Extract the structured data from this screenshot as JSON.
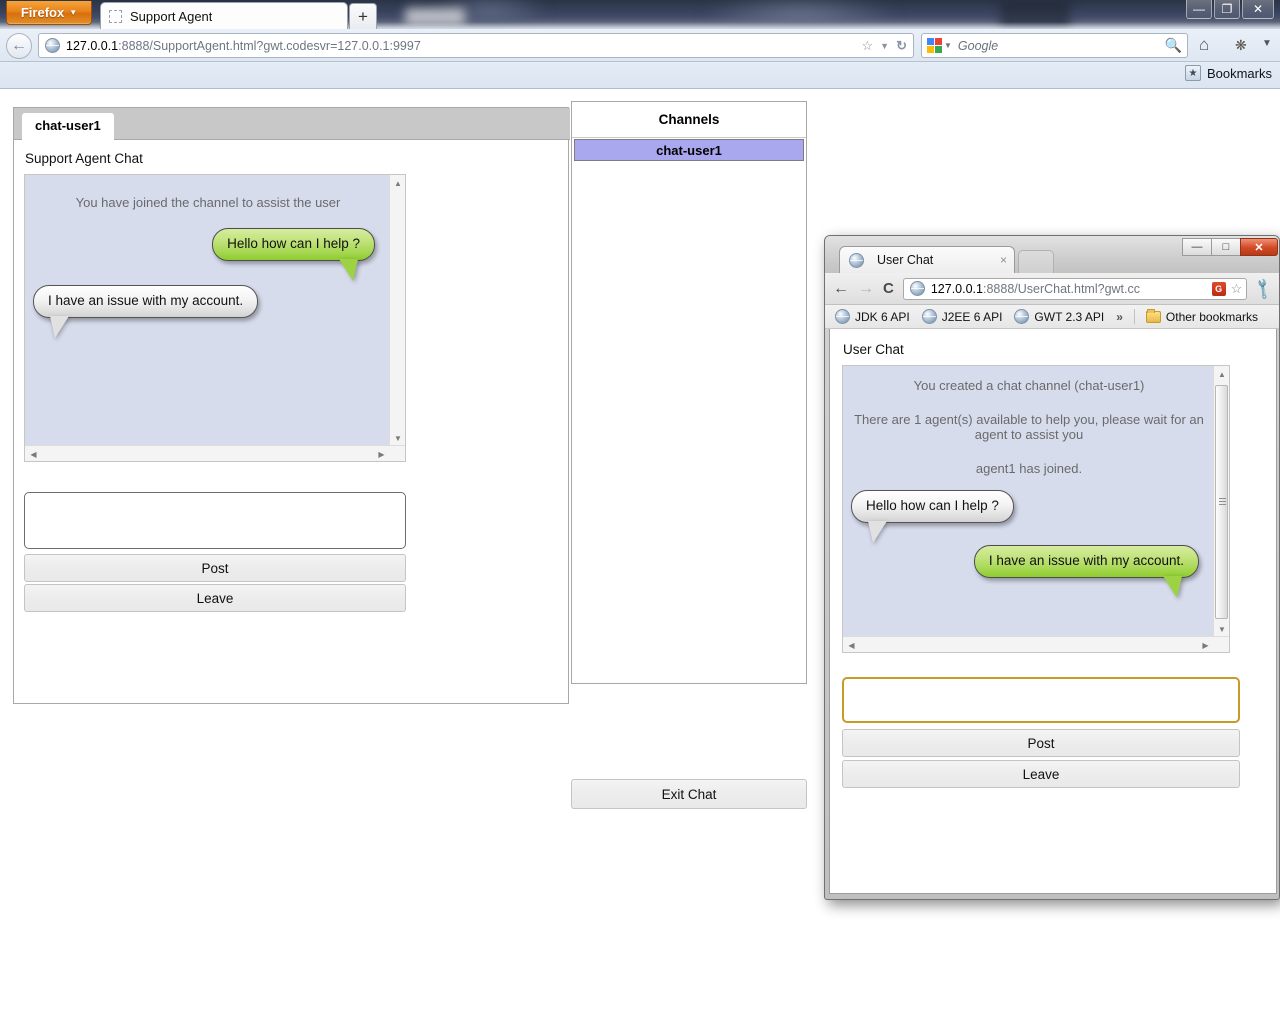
{
  "firefox": {
    "app_button_label": "Firefox",
    "tab_title": "Support Agent",
    "new_tab_label": "+",
    "url": "127.0.0.1",
    "url_rest": ":8888/SupportAgent.html?gwt.codesvr=127.0.0.1:9997",
    "search_placeholder": "Google",
    "bookmarks_label": "Bookmarks",
    "window_controls": {
      "minimize": "—",
      "maximize": "❐",
      "close": "✕"
    }
  },
  "agent_app": {
    "tab_label": "chat-user1",
    "caption": "Support Agent Chat",
    "system_message": "You have joined the channel to assist the user",
    "messages": [
      {
        "text": "Hello how can I help ?",
        "side": "right",
        "color": "green"
      },
      {
        "text": "I have an issue with my account.",
        "side": "left",
        "color": "grey"
      }
    ],
    "input_value": "",
    "post_label": "Post",
    "leave_label": "Leave"
  },
  "channels": {
    "header": "Channels",
    "items": [
      {
        "label": "chat-user1",
        "selected": true
      }
    ],
    "exit_label": "Exit Chat",
    "selected_color": "#a9a8ef"
  },
  "chrome": {
    "tab_title": "User Chat",
    "tab_close": "×",
    "url": "127.0.0.1",
    "url_rest": ":8888/UserChat.html?gwt.cc",
    "bookmarks": [
      "JDK 6 API",
      "J2EE 6 API",
      "GWT 2.3 API"
    ],
    "bookmarks_overflow": "»",
    "other_bookmarks": "Other bookmarks",
    "window_controls": {
      "minimize": "—",
      "maximize": "□",
      "close": "✕"
    },
    "back": "←",
    "forward": "→",
    "reload": "C",
    "star": "☆",
    "wrench": "ᴜ"
  },
  "user_app": {
    "caption": "User Chat",
    "system_messages": [
      "You created a chat channel (chat-user1)",
      "There are 1 agent(s) available to help you, please wait for an agent to assist you",
      "agent1 has joined."
    ],
    "messages": [
      {
        "text": "Hello how can I help ?",
        "side": "left",
        "color": "grey"
      },
      {
        "text": "I have an issue with my account.",
        "side": "right",
        "color": "green"
      }
    ],
    "input_value": "",
    "post_label": "Post",
    "leave_label": "Leave"
  },
  "colors": {
    "bubble_green": "#a9d957",
    "bubble_grey": "#e8e8e8",
    "chat_background": "#d7dced",
    "channel_selected": "#a9a8ef",
    "firefox_orange": "#e8821b"
  }
}
